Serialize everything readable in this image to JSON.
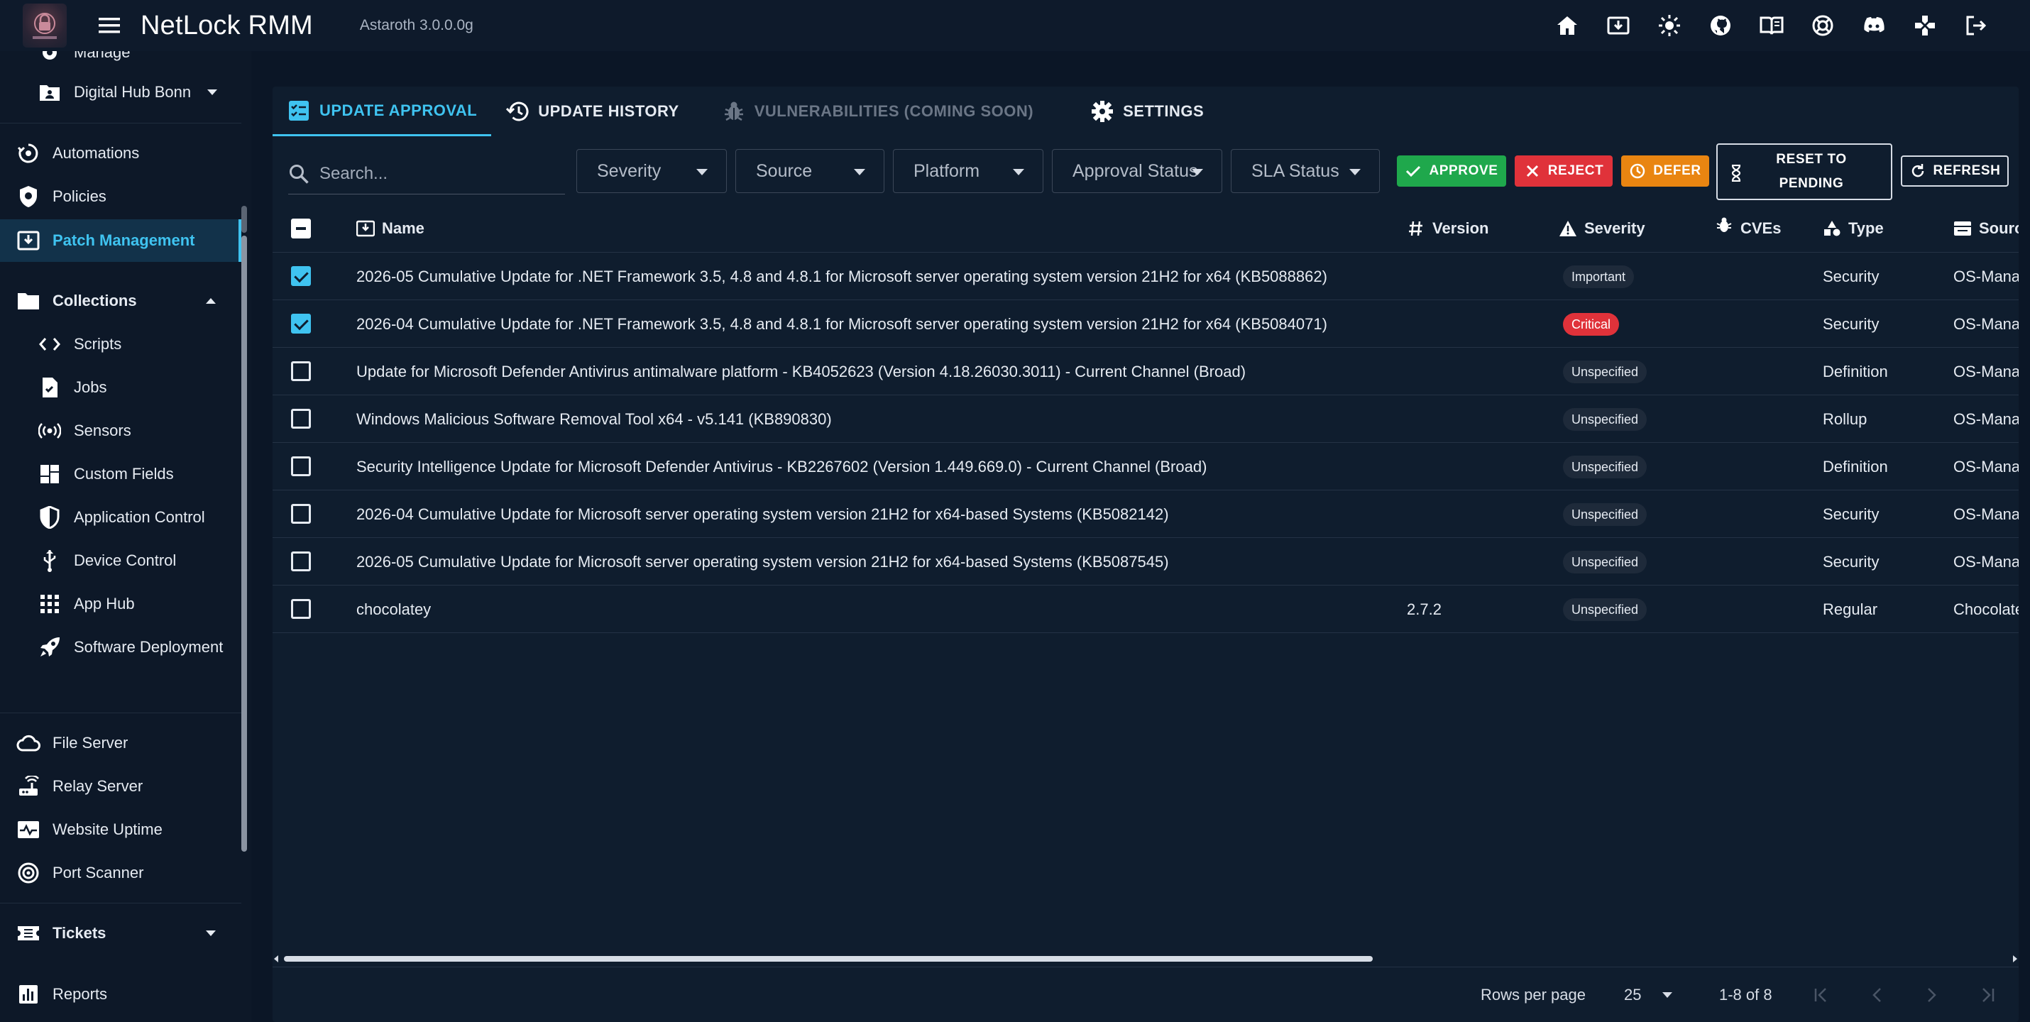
{
  "appbar": {
    "title": "NetLock RMM",
    "version": "Astaroth 3.0.0.0g",
    "icons": [
      "home-icon",
      "download-icon",
      "theme-toggle-icon",
      "github-icon",
      "docs-icon",
      "support-icon",
      "discord-icon",
      "games-icon",
      "logout-icon"
    ]
  },
  "sidebar": {
    "manage": "Manage",
    "digital_hub": "Digital Hub Bonn",
    "automations": "Automations",
    "policies": "Policies",
    "patch_management": "Patch Management",
    "collections": "Collections",
    "collection_items": [
      "Scripts",
      "Jobs",
      "Sensors",
      "Custom Fields",
      "Application Control",
      "Device Control",
      "App Hub",
      "Software Deployment"
    ],
    "servers": [
      "File Server",
      "Relay Server",
      "Website Uptime",
      "Port Scanner"
    ],
    "tickets": "Tickets",
    "reports": "Reports"
  },
  "tabs": {
    "update_approval": "UPDATE APPROVAL",
    "update_history": "UPDATE HISTORY",
    "vulnerabilities": "VULNERABILITIES (COMING SOON)",
    "settings": "SETTINGS"
  },
  "toolbar": {
    "search_placeholder": "Search...",
    "filters": [
      "Severity",
      "Source",
      "Platform",
      "Approval Status",
      "SLA Status"
    ],
    "approve": "APPROVE",
    "reject": "REJECT",
    "defer": "DEFER",
    "reset_line1": "RESET TO",
    "reset_line2": "PENDING",
    "refresh": "REFRESH"
  },
  "colors": {
    "accent": "#3fc3f0",
    "approve": "#1fa84c",
    "reject": "#e0323a",
    "defer": "#e98511"
  },
  "table": {
    "columns": {
      "name": "Name",
      "version": "Version",
      "severity": "Severity",
      "cves": "CVEs",
      "type": "Type",
      "source": "Source"
    },
    "rows": [
      {
        "checked": true,
        "name": "2026-05 Cumulative Update for .NET Framework 3.5, 4.8 and 4.8.1 for Microsoft server operating system version 21H2 for x64 (KB5088862)",
        "version": "",
        "severity": "Important",
        "type": "Security",
        "source": "OS-Managed"
      },
      {
        "checked": true,
        "name": "2026-04 Cumulative Update for .NET Framework 3.5, 4.8 and 4.8.1 for Microsoft server operating system version 21H2 for x64 (KB5084071)",
        "version": "",
        "severity": "Critical",
        "type": "Security",
        "source": "OS-Managed"
      },
      {
        "checked": false,
        "name": "Update for Microsoft Defender Antivirus antimalware platform - KB4052623 (Version 4.18.26030.3011) - Current Channel (Broad)",
        "version": "",
        "severity": "Unspecified",
        "type": "Definition",
        "source": "OS-Managed"
      },
      {
        "checked": false,
        "name": "Windows Malicious Software Removal Tool x64 - v5.141 (KB890830)",
        "version": "",
        "severity": "Unspecified",
        "type": "Rollup",
        "source": "OS-Managed"
      },
      {
        "checked": false,
        "name": "Security Intelligence Update for Microsoft Defender Antivirus - KB2267602 (Version 1.449.669.0) - Current Channel (Broad)",
        "version": "",
        "severity": "Unspecified",
        "type": "Definition",
        "source": "OS-Managed"
      },
      {
        "checked": false,
        "name": "2026-04 Cumulative Update for Microsoft server operating system version 21H2 for x64-based Systems (KB5082142)",
        "version": "",
        "severity": "Unspecified",
        "type": "Security",
        "source": "OS-Managed"
      },
      {
        "checked": false,
        "name": "2026-05 Cumulative Update for Microsoft server operating system version 21H2 for x64-based Systems (KB5087545)",
        "version": "",
        "severity": "Unspecified",
        "type": "Security",
        "source": "OS-Managed"
      },
      {
        "checked": false,
        "name": "chocolatey",
        "version": "2.7.2",
        "severity": "Unspecified",
        "type": "Regular",
        "source": "Chocolatey"
      }
    ]
  },
  "footer": {
    "rows_per_page_label": "Rows per page",
    "rows_per_page": "25",
    "range": "1-8 of 8"
  }
}
